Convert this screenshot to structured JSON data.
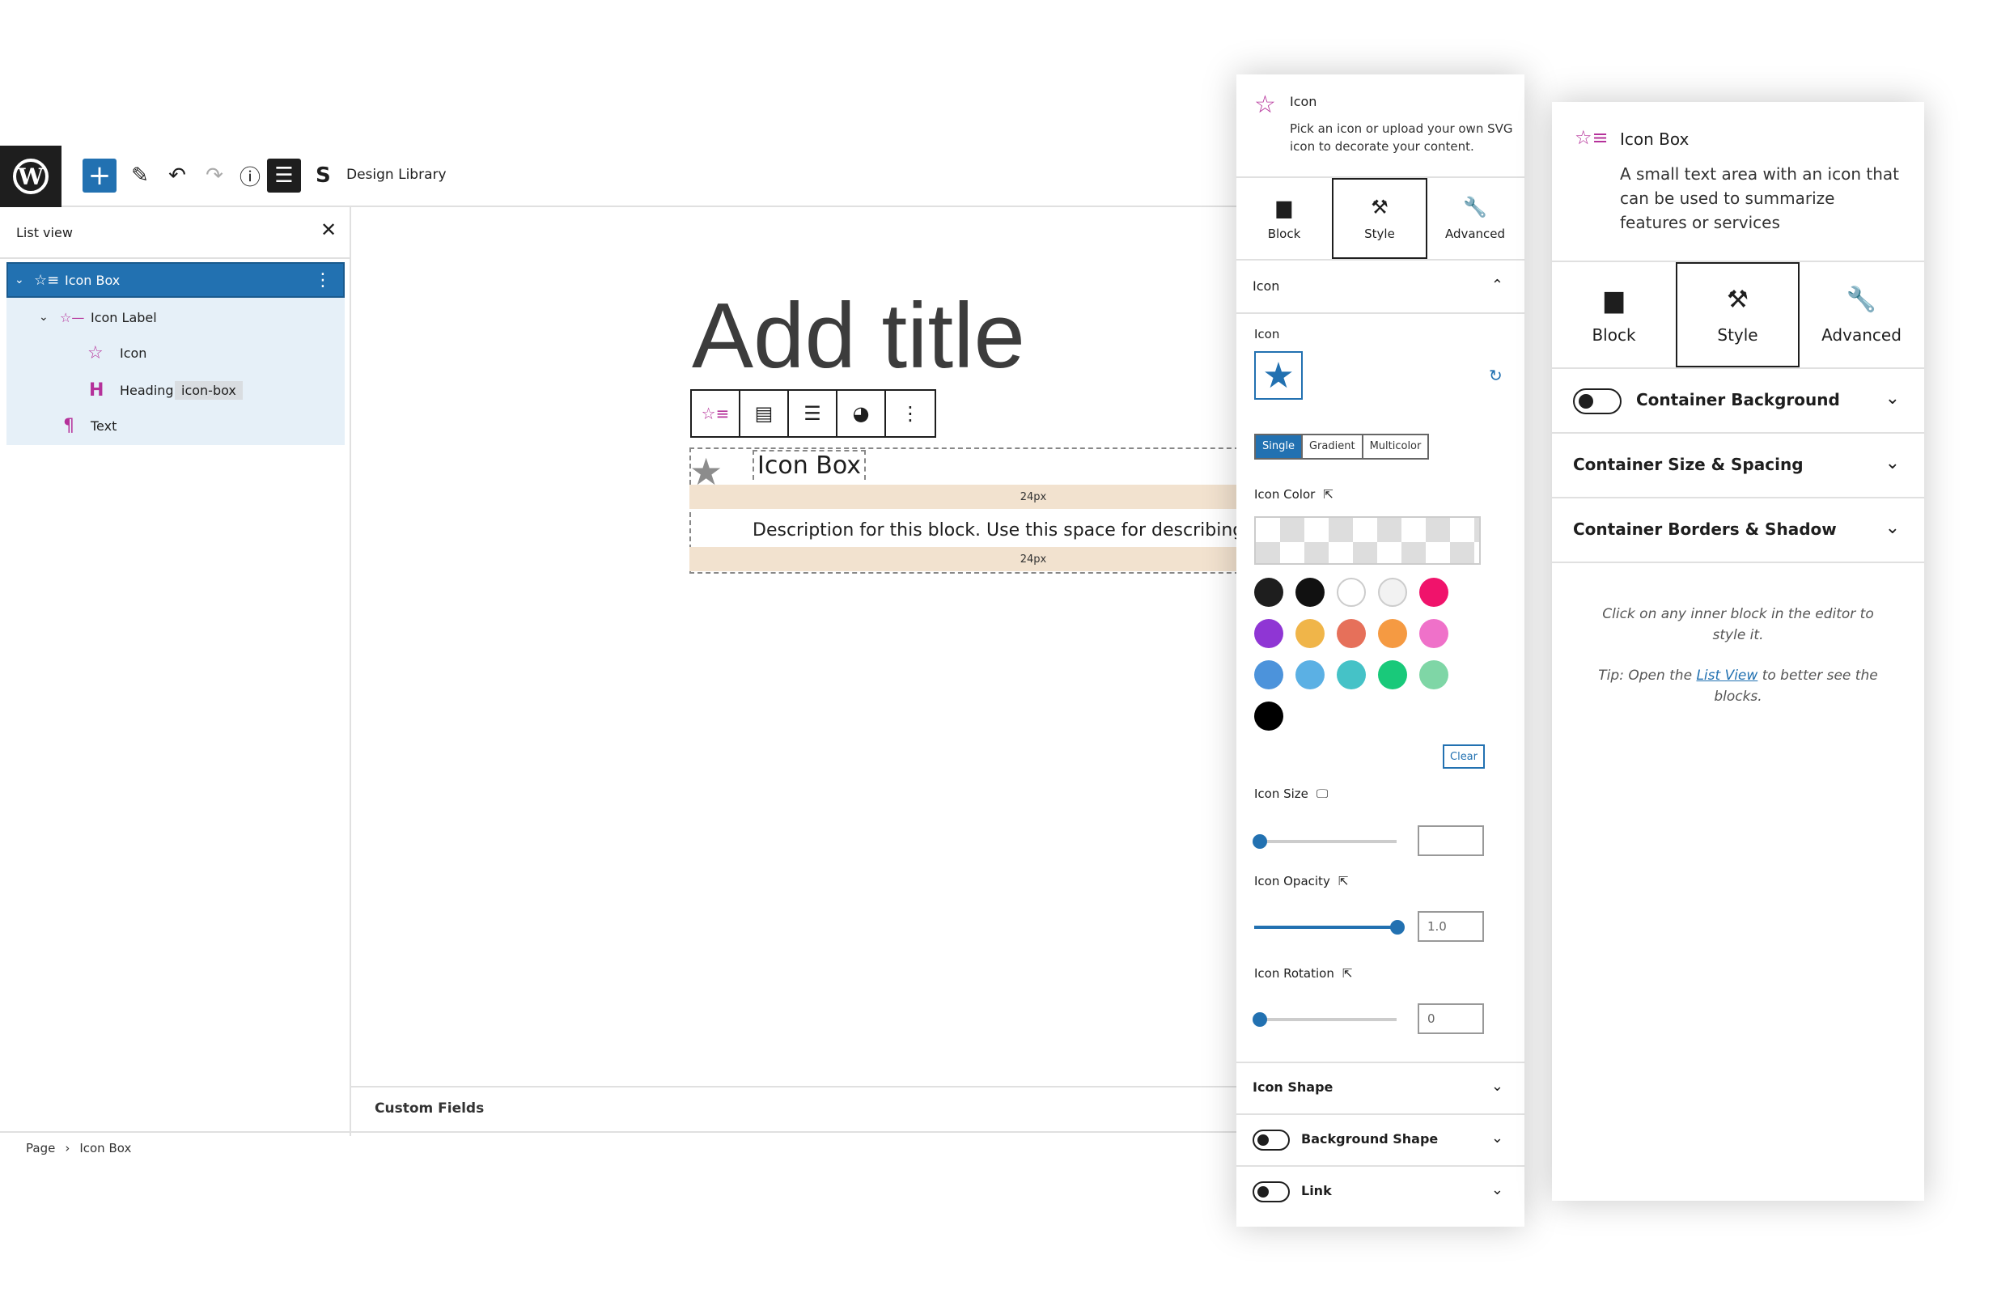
{
  "toolbar": {
    "add_icon": "+",
    "edit_icon": "✎",
    "undo_icon": "↶",
    "redo_icon": "↷",
    "info_icon": "ⓘ",
    "listview_icon": "☰",
    "design_library_label": "Design Library"
  },
  "listview": {
    "title": "List view",
    "items": [
      {
        "label": "Icon Box",
        "icon": "icon-box-icon"
      },
      {
        "label": "Icon Label",
        "icon": "icon-label-icon"
      },
      {
        "label": "Icon",
        "icon": "star-icon"
      },
      {
        "label": "Heading",
        "tag": "icon-box",
        "icon": "heading-icon"
      },
      {
        "label": "Text",
        "icon": "paragraph-icon"
      }
    ]
  },
  "canvas": {
    "title_placeholder": "Add title",
    "block_heading": "Icon Box",
    "spacer_1": "24px",
    "block_description": "Description for this block. Use this space for describing your block.",
    "spacer_2": "24px"
  },
  "custom_fields": "Custom Fields",
  "breadcrumb": {
    "items": [
      "Page",
      "Icon Box"
    ]
  },
  "inspector": {
    "block_title": "Icon",
    "block_desc": "Pick an icon or upload your own SVG icon to decorate your content.",
    "tabs": [
      {
        "label": "Block",
        "icon": "block-icon"
      },
      {
        "label": "Style",
        "icon": "style-icon",
        "active": true
      },
      {
        "label": "Advanced",
        "icon": "advanced-icon"
      }
    ],
    "section_icon": "Icon",
    "icon_label": "Icon",
    "color_modes": [
      "Single",
      "Gradient",
      "Multicolor"
    ],
    "icon_color_label": "Icon Color",
    "swatches": [
      "#1e1e1e",
      "#111111",
      "#ffffff",
      "#f2f2f2",
      "#f0136b",
      "#8f36d4",
      "#f0b549",
      "#e6705a",
      "#f59a42",
      "#ef71c9",
      "#4c93db",
      "#5bb0e4",
      "#45c2c7",
      "#19c97a",
      "#7fd6a6",
      "#000000"
    ],
    "clear_label": "Clear",
    "icon_size_label": "Icon Size",
    "icon_size_value": "",
    "icon_opacity_label": "Icon Opacity",
    "icon_opacity_value": "1.0",
    "icon_rotation_label": "Icon Rotation",
    "icon_rotation_value": "0",
    "icon_shape_label": "Icon Shape",
    "background_shape_label": "Background Shape",
    "link_label": "Link"
  },
  "right_panel": {
    "block_title": "Icon Box",
    "block_desc": "A small text area with an icon that can be used to summarize features or services",
    "tabs": [
      {
        "label": "Block",
        "icon": "block-icon"
      },
      {
        "label": "Style",
        "icon": "style-icon",
        "active": true
      },
      {
        "label": "Advanced",
        "icon": "advanced-icon"
      }
    ],
    "sections": [
      "Container Background",
      "Container Size & Spacing",
      "Container Borders & Shadow"
    ],
    "hint": "Click on any inner block in the editor to style it.",
    "tip_prefix": "Tip: Open the",
    "tip_link": "List View",
    "tip_suffix": "to better see the blocks."
  },
  "colors": {
    "accent": "#2271b1",
    "brand_pink": "#b5319a"
  }
}
